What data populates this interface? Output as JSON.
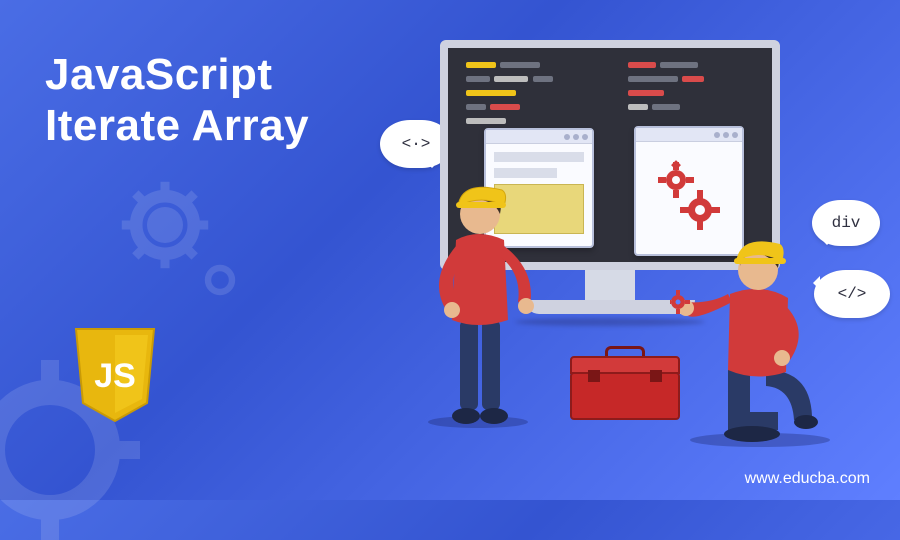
{
  "title_line1": "JavaScript",
  "title_line2": "Iterate Array",
  "logo_text": "JS",
  "footer_url": "www.educba.com",
  "bubbles": {
    "tag_open": "<·>",
    "div": "div",
    "tag_close": "</>"
  },
  "colors": {
    "accent_red": "#d13a3a",
    "js_yellow": "#f0c419",
    "bg_blue": "#4a6de5"
  }
}
